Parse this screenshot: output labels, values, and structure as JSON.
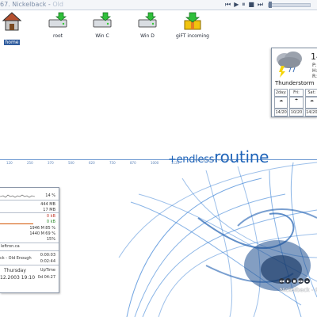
{
  "topbar": {
    "title": "67. Nickelback - ",
    "title_fade": "Old",
    "controls": {
      "prev": "⏮",
      "play": "▶",
      "pause": "⏸",
      "stop": "■",
      "next": "⏭",
      "eject": "⏏"
    },
    "volume": 0.0
  },
  "desktop_icons": [
    {
      "label": "home",
      "icon": "home-icon"
    },
    {
      "label": "root",
      "icon": "drive-icon"
    },
    {
      "label": "Win C",
      "icon": "drive-icon"
    },
    {
      "label": "Win D",
      "icon": "drive-icon"
    },
    {
      "label": "giFT incoming",
      "icon": "download-icon"
    }
  ],
  "wallpaper": {
    "brand_small": "+endless",
    "brand_big": "routine",
    "tagline": "kde-look.org   by cazzo",
    "ruler_ticks": [
      "120",
      "250",
      "370",
      "500",
      "620",
      "750",
      "870",
      "1000",
      "1120"
    ],
    "accent": "#1e63b8"
  },
  "weather": {
    "temp": "14",
    "lines": [
      "P:",
      "H:",
      "R:"
    ],
    "condition": "Thunderstorm",
    "days": [
      "2day:",
      "Fri:",
      "Sat:"
    ],
    "temps": [
      "14/20",
      "10/20",
      "14/20"
    ]
  },
  "monitor": {
    "cpu_pct": "14 %",
    "mem_total": "444 MB",
    "mem_used": "17 MB",
    "net_in": "0 kB",
    "net_out": "0 kB",
    "disk1": "1946 M",
    "disk1_pct": "85 %",
    "disk2": "1440 M",
    "disk2_pct": "69 %",
    "swap_pct": "15%",
    "host": "leftron.ca",
    "track": "ck - Old Enough",
    "t1": "0:00:03",
    "t2": "0:02:44",
    "day": "Thursday",
    "date": "12.2003 19:10",
    "uptime_label": "UpTime",
    "uptime": "0d 04:27"
  },
  "player": {
    "buttons": [
      "◀◀",
      "▶",
      "■",
      "▶▶",
      "⏏"
    ],
    "title": "Nickelback - O"
  }
}
